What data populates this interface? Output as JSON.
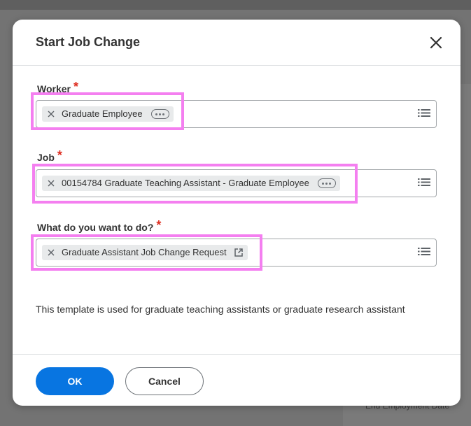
{
  "background": {
    "partial_text": "End Employment Date"
  },
  "dialog": {
    "title": "Start Job Change",
    "fields": [
      {
        "label": "Worker",
        "required_mark": "*",
        "value": "Graduate Employee"
      },
      {
        "label": "Job",
        "required_mark": "*",
        "value": "00154784 Graduate Teaching Assistant - Graduate Employee"
      },
      {
        "label": "What do you want to do?",
        "required_mark": "*",
        "value": "Graduate Assistant Job Change Request"
      }
    ],
    "description": "This template is used for graduate teaching assistants or graduate research assistant",
    "ok_label": "OK",
    "cancel_label": "Cancel"
  },
  "colors": {
    "primary": "#0875e1",
    "required": "#de2e21",
    "highlight": "#f47ff0",
    "pill_bg": "#e8eaeb"
  },
  "icons": {
    "close": "close-icon",
    "remove": "x-icon",
    "more": "more-options-icon",
    "external": "external-link-icon",
    "prompt": "list-icon"
  }
}
